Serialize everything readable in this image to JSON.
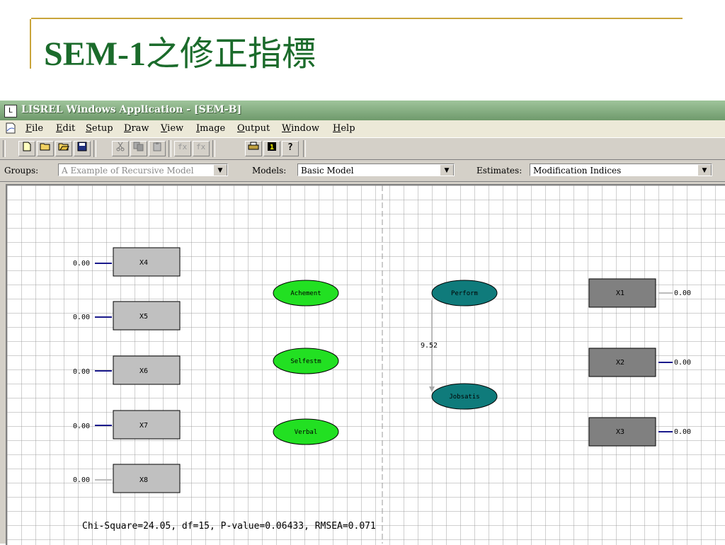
{
  "slide": {
    "title_latin": "SEM-1",
    "title_cjk": "之修正指標"
  },
  "window": {
    "title": "LISREL Windows Application - [SEM-B]",
    "menu": [
      "File",
      "Edit",
      "Setup",
      "Draw",
      "View",
      "Image",
      "Output",
      "Window",
      "Help"
    ],
    "toolbar_icons": [
      "new-icon",
      "open-icon",
      "open-folder-icon",
      "save-icon",
      "cut-icon",
      "copy-icon",
      "paste-icon",
      "path-diagram-icon",
      "path-diagram-alt-icon",
      "print-icon",
      "info-icon",
      "help-icon"
    ]
  },
  "selectors": {
    "groups_label": "Groups:",
    "groups_value": "A Example of Recursive Model",
    "models_label": "Models:",
    "models_value": "Basic Model",
    "estimates_label": "Estimates:",
    "estimates_value": "Modification Indices"
  },
  "diagram": {
    "x_vars": [
      {
        "name": "X4",
        "error": "0.00"
      },
      {
        "name": "X5",
        "error": "0.00"
      },
      {
        "name": "X6",
        "error": "0.00"
      },
      {
        "name": "X7",
        "error": "0.00"
      },
      {
        "name": "X8",
        "error": "0.00"
      }
    ],
    "exogenous_latents": [
      "Achement",
      "Selfestm",
      "Verbal"
    ],
    "endogenous_latents": [
      "Perform",
      "Jobsatis"
    ],
    "path_value": "9.52",
    "y_vars": [
      {
        "name": "X1",
        "error": "0.00"
      },
      {
        "name": "X2",
        "error": "0.00"
      },
      {
        "name": "X3",
        "error": "0.00"
      }
    ],
    "fit_statistics": "Chi-Square=24.05, df=15, P-value=0.06433, RMSEA=0.071"
  },
  "colors": {
    "title_green": "#1b6b2b",
    "exogenous_fill": "#22e022",
    "endogenous_fill": "#0f7b7b",
    "x_box_fill": "#c0c0c0",
    "y_box_fill": "#808080",
    "arrow_blue": "#1a1a8c"
  }
}
